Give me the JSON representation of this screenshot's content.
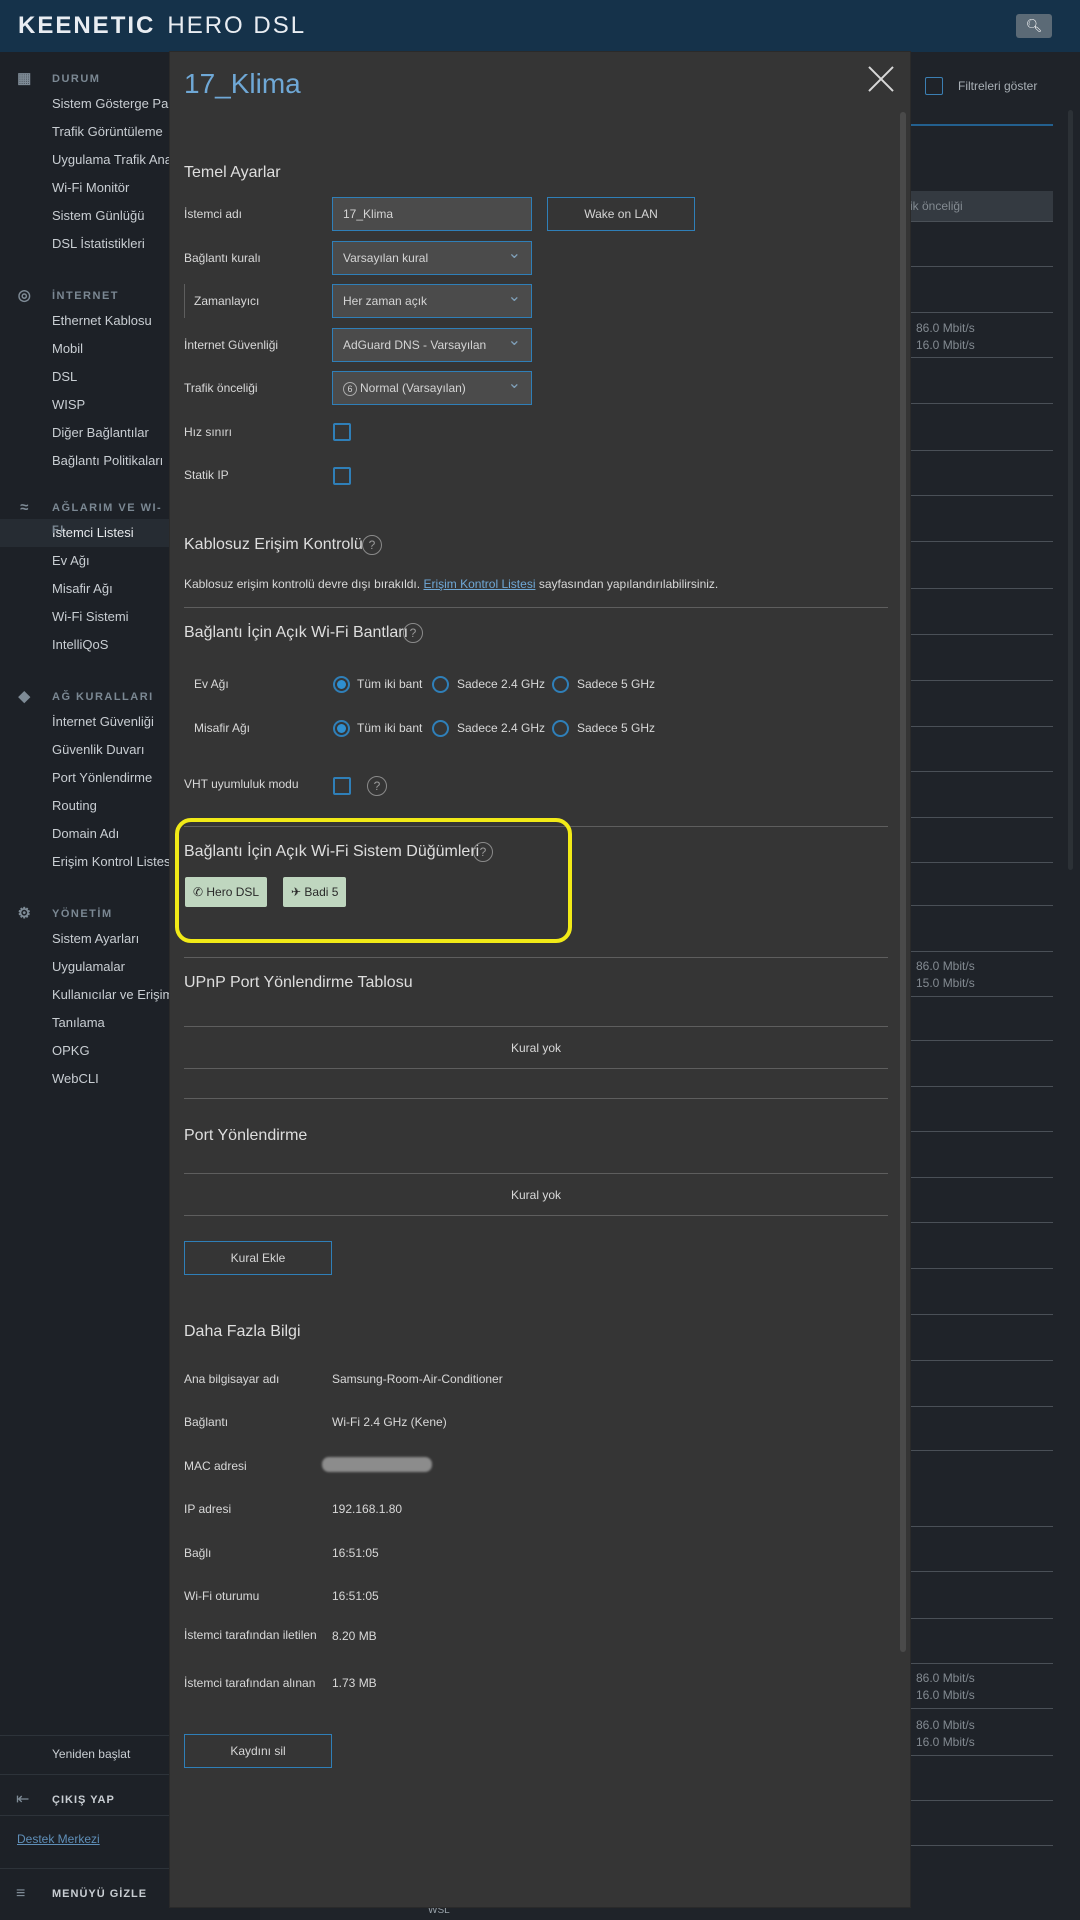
{
  "topbar": {
    "brand": "KEENETIC",
    "model": "HERO DSL",
    "search_icon": "search-icon"
  },
  "sidebar": {
    "sections": [
      {
        "title": "DURUM",
        "icon": "dashboard-icon",
        "items": [
          "Sistem Gösterge Paneli",
          "Trafik Görüntüleme",
          "Uygulama Trafik Analizi",
          "Wi-Fi Monitör",
          "Sistem Günlüğü",
          "DSL İstatistikleri"
        ]
      },
      {
        "title": "İNTERNET",
        "icon": "globe-icon",
        "items": [
          "Ethernet Kablosu",
          "Mobil",
          "DSL",
          "WISP",
          "Diğer Bağlantılar",
          "Bağlantı Politikaları"
        ]
      },
      {
        "title": "AĞLARIM VE WI-FI",
        "icon": "wifi-icon",
        "items": [
          "İstemci Listesi",
          "Ev Ağı",
          "Misafir Ağı",
          "Wi-Fi Sistemi",
          "IntelliQoS"
        ]
      },
      {
        "title": "AĞ KURALLARI",
        "icon": "shield-icon",
        "items": [
          "İnternet Güvenliği",
          "Güvenlik Duvarı",
          "Port Yönlendirme",
          "Routing",
          "Domain Adı",
          "Erişim Kontrol Listesi"
        ]
      },
      {
        "title": "YÖNETİM",
        "icon": "gear-icon",
        "items": [
          "Sistem Ayarları",
          "Uygulamalar",
          "Kullanıcılar ve Erişim",
          "Tanılama",
          "OPKG",
          "WebCLI"
        ]
      }
    ],
    "restart": "Yeniden başlat",
    "logout": "ÇIKIŞ YAP",
    "support": "Destek Merkezi",
    "hide_menu": "MENÜYÜ GİZLE"
  },
  "background": {
    "filter_label": "Filtreleri göster",
    "column_header": "ik önceliği",
    "speeds": [
      [
        "86.0 Mbit/s",
        "16.0 Mbit/s"
      ],
      [
        "86.0 Mbit/s",
        "15.0 Mbit/s"
      ],
      [
        "86.0 Mbit/s",
        "16.0 Mbit/s"
      ],
      [
        "86.0 Mbit/s",
        "16.0 Mbit/s"
      ]
    ],
    "bottom_tab": "WSL"
  },
  "modal": {
    "title": "17_Klima",
    "basic": {
      "heading": "Temel Ayarlar",
      "client_name_label": "İstemci adı",
      "client_name_value": "17_Klima",
      "wol_button": "Wake on LAN",
      "rule_label": "Bağlantı kuralı",
      "rule_value": "Varsayılan kural",
      "scheduler_label": "Zamanlayıcı",
      "scheduler_value": "Her zaman açık",
      "security_label": "İnternet Güvenliği",
      "security_value": "AdGuard DNS - Varsayılan",
      "priority_label": "Trafik önceliği",
      "priority_icon_text": "6",
      "priority_value": "Normal (Varsayılan)",
      "speed_limit_label": "Hız sınırı",
      "static_ip_label": "Statik IP"
    },
    "wireless_acl": {
      "heading": "Kablosuz Erişim Kontrolü",
      "text_before": "Kablosuz erişim kontrolü devre dışı bırakıldı.",
      "link": "Erişim Kontrol Listesi",
      "text_after": "sayfasından yapılandırılabilirsiniz."
    },
    "bands": {
      "heading": "Bağlantı İçin Açık Wi-Fi Bantları",
      "home_label": "Ev Ağı",
      "guest_label": "Misafir Ağı",
      "options": [
        "Tüm iki bant",
        "Sadece 2.4 GHz",
        "Sadece 5 GHz"
      ],
      "vht_label": "VHT uyumluluk modu"
    },
    "nodes": {
      "heading": "Bağlantı İçin Açık Wi-Fi Sistem Düğümleri",
      "items": [
        "Hero DSL",
        "Badi 5"
      ]
    },
    "upnp": {
      "heading": "UPnP Port Yönlendirme Tablosu",
      "empty": "Kural yok"
    },
    "port_forward": {
      "heading": "Port Yönlendirme",
      "empty": "Kural yok",
      "add_button": "Kural Ekle"
    },
    "info": {
      "heading": "Daha Fazla Bilgi",
      "rows": [
        {
          "label": "Ana bilgisayar adı",
          "value": "Samsung-Room-Air-Conditioner"
        },
        {
          "label": "Bağlantı",
          "value": "Wi-Fi 2.4 GHz (Kene)"
        },
        {
          "label": "MAC adresi",
          "value": ""
        },
        {
          "label": "IP adresi",
          "value": "192.168.1.80"
        },
        {
          "label": "Bağlı",
          "value": "16:51:05"
        },
        {
          "label": "Wi-Fi oturumu",
          "value": "16:51:05"
        },
        {
          "label": "İstemci tarafından iletilen",
          "value": "8.20 MB"
        },
        {
          "label": "İstemci tarafından alınan",
          "value": "1.73 MB"
        }
      ]
    },
    "delete_button": "Kaydını sil"
  }
}
